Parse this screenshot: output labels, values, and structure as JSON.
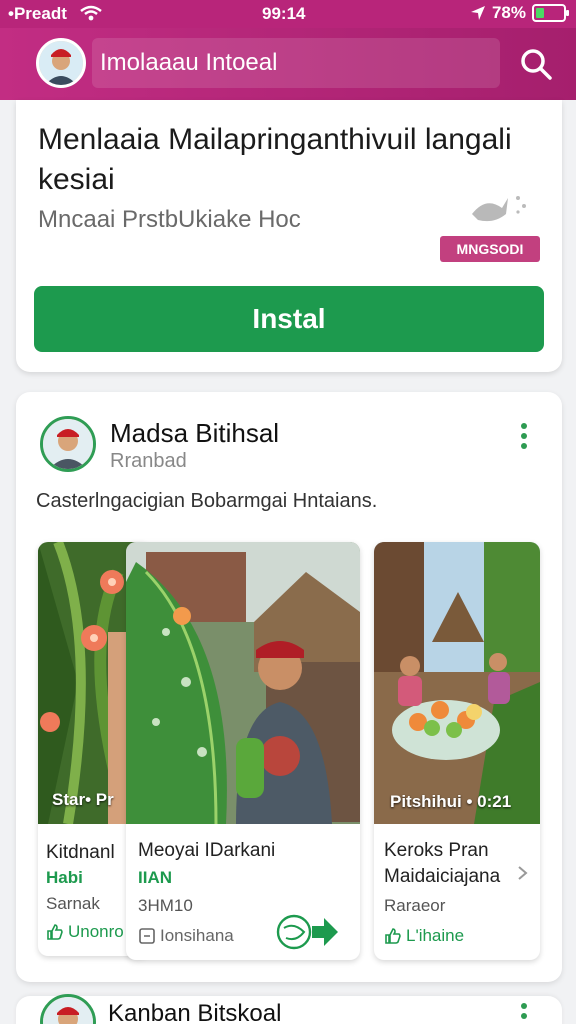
{
  "status_bar": {
    "carrier": "•Preadt",
    "time": "99:14",
    "battery": "78%"
  },
  "header": {
    "search_text": "Imolaaau Intoeal"
  },
  "install_card": {
    "title": "Menlaaia Mailapringanthivuil langali kesiai",
    "subtitle": "Mncaai PrstbUkiake Hoc",
    "badge": "MNGSODI",
    "button_label": "Instal"
  },
  "post": {
    "author": "Madsa Bitihsal",
    "handle": "Rranbad",
    "text": "Casterlngacigian  Bobarmgai Hntaians.",
    "products": [
      {
        "caption": "Star• Pr",
        "title": "Kitdnanl",
        "price": "Habi",
        "meta": "Sarnak",
        "action": "Unonro"
      },
      {
        "caption": "",
        "title": "Meoyai IDarkani",
        "price": "IIAN",
        "meta": "3HM10",
        "action": "Ionsihana"
      },
      {
        "caption": "Pitshihui • 0:21",
        "title": "Keroks Pran Maidaiciajana",
        "price": "",
        "meta": "Raraeor",
        "action": "L'ihaine"
      }
    ]
  },
  "next_post": {
    "author": "Kanban Bitskoal"
  },
  "colors": {
    "brand": "#b8257a",
    "accent_green": "#1d9a4e",
    "badge": "#c2407f"
  },
  "icons": [
    "wifi-icon",
    "location-arrow-icon",
    "battery-icon",
    "search-icon",
    "more-vertical-icon",
    "share-arrow-icon",
    "like-icon",
    "comment-icon"
  ]
}
